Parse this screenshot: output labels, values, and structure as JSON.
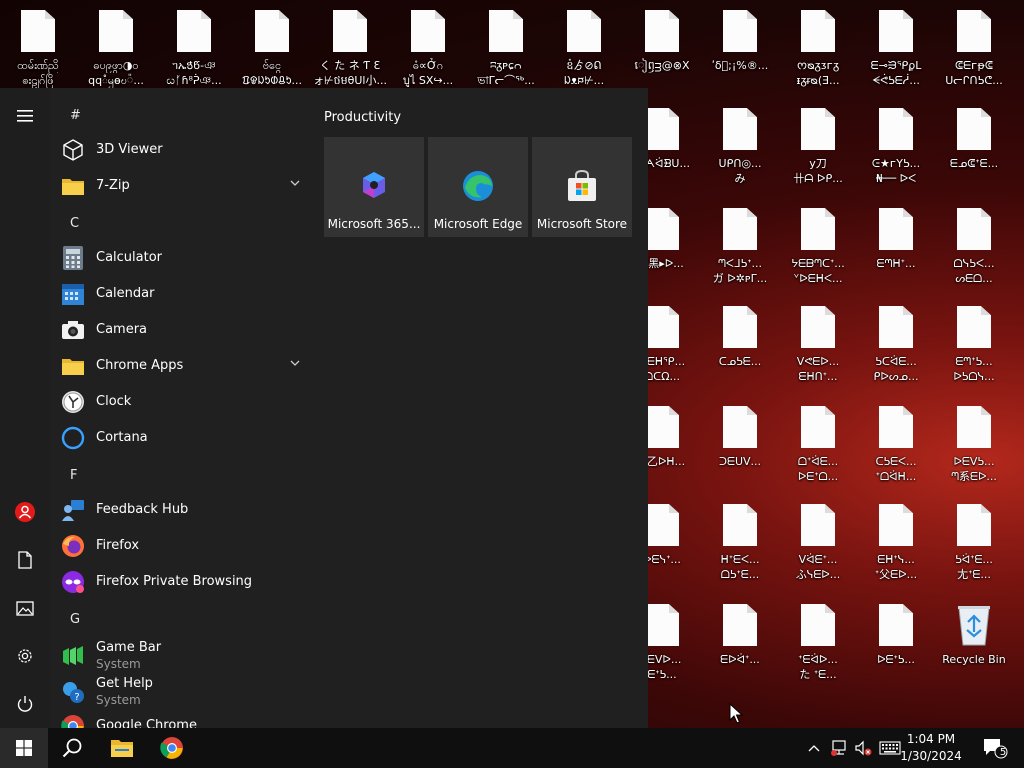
{
  "desktop": {
    "icons": [
      {
        "label1": "ထမ်းဏ်ညိ",
        "label2": "ၜးဠုဂ်ဖြိ"
      },
      {
        "label1": "ဓပ၉ဖွာ◑ဝ",
        "label2": "qqᰱၝɵဎ៉..."
      },
      {
        "label1": "ᥐኤᲭᲬ-ঞ",
        "label2": "ᦍᚪɦ⁸ᕉঞ..."
      },
      {
        "label1": "ဗ်ငွေ",
        "label2": "ᱯᱫᱡᱩᱰᱪᱩ..."
      },
      {
        "label1": "く た ネ Ƭ Ɛ",
        "label2": "ォ⊬ថមθUl小..."
      },
      {
        "label1": "ဓံ∝Ởဂ",
        "label2": "บูไ SX↪..."
      },
      {
        "label1": "ʭᵹᴘɕᴒ",
        "label2": "ভাᒥᓕ⌒ᖅ..."
      },
      {
        "label1": "ឧ៎ゟ⊘ᕠ",
        "label2": "ᱡᴥᰐ⊬..."
      },
      {
        "label1": "ៀឭᴟ@⊗X",
        "label2": ""
      },
      {
        "label1": "ʹδ᪸;¡%®...",
        "label2": ""
      },
      {
        "label1": "ᰔᴓᵹᴣᴦᵹ",
        "label2": "ᵻᵹᵲᴓ(Ǝ..."
      },
      {
        "label1": "ᗴ⊸ᙐᕿϼᒪ",
        "label2": "ᗕᕚᕊᗴᓲ..."
      },
      {
        "label1": "ᕳᗴᴦᵽᕳ",
        "label2": "ᑌᓕᒋᑎᕊᕦ..."
      },
      {
        "label1": "ᑀᗅᐛᗿᑌ...",
        "label2": ""
      },
      {
        "label1": "ᑌᑭᑎ◎...",
        "label2": "み"
      },
      {
        "label1": "у刀",
        "label2": "卄ᗩ ᐅᑭ..."
      },
      {
        "label1": "ᕮ★ᴦYᕊ...",
        "label2": "₦── ᐅᐸ"
      },
      {
        "label1": "ᗴᓄᕳᐩᗴ...",
        "label2": ""
      },
      {
        "label1": "ᑕ黑▸ᐅ...",
        "label2": ""
      },
      {
        "label1": "ᘉᐸᒧᕊᐩ...",
        "label2": "ガ ᐅ✲ᴘᒥ..."
      },
      {
        "label1": "ᔭᗴᗷᘉᑕᐩ...",
        "label2": "ᘁᐅᗴᕼᐸ..."
      },
      {
        "label1": "ᗴᘉᕼᐩ...",
        "label2": ""
      },
      {
        "label1": "ᗝᓭᕊᐸ...",
        "label2": "ᔕᗴᗝ..."
      },
      {
        "label1": "ᘉᗴᕼᕿ...",
        "label2": "ᗝᑕΩ..."
      },
      {
        "label1": "ᑕᓄᕊᗴ...",
        "label2": ""
      },
      {
        "label1": "ᐯᕙᗴᐅ...",
        "label2": "ᗴᕼᑎᐩ..."
      },
      {
        "label1": "ᕊᑕᐛᗴ...",
        "label2": "ᑭᐅᔕᓄ..."
      },
      {
        "label1": "ᗴᘉᐩᕊ...",
        "label2": "ᐅᕊᗝᓭ..."
      },
      {
        "label1": "ᘉ乙ᐅᕼ...",
        "label2": ""
      },
      {
        "label1": "ᑐᗴᑌᐯ...",
        "label2": ""
      },
      {
        "label1": "ᗝᐩᐛᗴ...",
        "label2": "ᐅᗴᐩᗝ..."
      },
      {
        "label1": "ᑕᕊᗴᐸ...",
        "label2": "ᐩᗝᐛᕼ..."
      },
      {
        "label1": "ᐅᗴᐯᕊ...",
        "label2": "ᘉ系ᗴᐅ..."
      },
      {
        "label1": "ᐅᗴᓭᐩ...",
        "label2": ""
      },
      {
        "label1": "ᕼᐩᗴᐸ...",
        "label2": "ᗝᕊᐩᗴ..."
      },
      {
        "label1": "ᐯᐛᗴᐩ...",
        "label2": "ふᓭᗴᐅ..."
      },
      {
        "label1": "ᗴᕼᐩᓭ...",
        "label2": "ᐩ父ᗴᐅ..."
      },
      {
        "label1": "ᕊᐛᐩᗴ...",
        "label2": "尢ᐩᗴ..."
      },
      {
        "label1": "ᐩᗴᐯᐅ...",
        "label2": "ᗴᐩᕊ..."
      },
      {
        "label1": "ᗴᐅᐛᐩ...",
        "label2": ""
      },
      {
        "label1": "ᐩᗴᐛᐅ...",
        "label2": "た ᐩᗴ..."
      },
      {
        "label1": "ᐅᗴᐩᕊ...",
        "label2": ""
      }
    ],
    "recycle_bin": "Recycle Bin"
  },
  "start_menu": {
    "rail": {
      "menu_icon": "hamburger-icon",
      "user_icon": "user-icon",
      "documents_icon": "document-icon",
      "pictures_icon": "pictures-icon",
      "settings_icon": "gear-icon",
      "power_icon": "power-icon"
    },
    "headers": {
      "hash": "#",
      "c": "C",
      "f": "F",
      "g": "G"
    },
    "apps": {
      "viewer3d": "3D Viewer",
      "sevenzip": "7-Zip",
      "calculator": "Calculator",
      "calendar": "Calendar",
      "camera": "Camera",
      "chrome_apps": "Chrome Apps",
      "clock": "Clock",
      "cortana": "Cortana",
      "feedback": "Feedback Hub",
      "firefox": "Firefox",
      "firefox_private": "Firefox Private Browsing",
      "gamebar": "Game Bar",
      "gamebar_sub": "System",
      "gethelp": "Get Help",
      "gethelp_sub": "System",
      "chrome": "Google Chrome"
    },
    "tiles": {
      "group_title": "Productivity",
      "items": [
        "Microsoft 365...",
        "Microsoft Edge",
        "Microsoft Store"
      ]
    }
  },
  "taskbar": {
    "time": "1:04 PM",
    "date": "1/30/2024",
    "notification_count": "5"
  },
  "colors": {
    "start_bg": "#202020",
    "tile_bg": "#333333",
    "taskbar_bg": "#0f0f0f"
  }
}
